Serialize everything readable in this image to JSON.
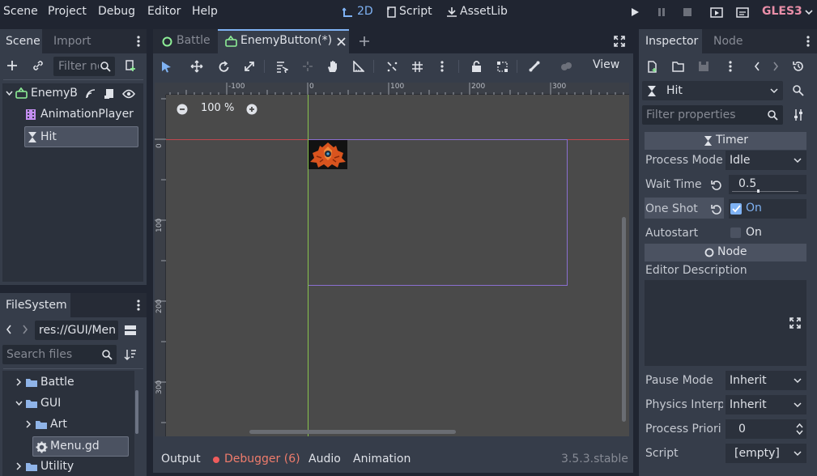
{
  "menu": {
    "scene": "Scene",
    "project": "Project",
    "debug": "Debug",
    "editor": "Editor",
    "help": "Help"
  },
  "workspaces": {
    "view2d": "2D",
    "script": "Script",
    "assetlib": "AssetLib"
  },
  "renderer": "GLES3",
  "scene_dock": {
    "tab_scene": "Scene",
    "tab_import": "Import",
    "filter_placeholder": "Filter nodes",
    "tree": [
      {
        "label": "EnemyB",
        "type": "root"
      },
      {
        "label": "AnimationPlayer",
        "type": "animation"
      },
      {
        "label": "Hit",
        "type": "timer"
      }
    ]
  },
  "filesystem": {
    "tab": "FileSystem",
    "path": "res://GUI/Menu",
    "search_placeholder": "Search files",
    "items": [
      {
        "label": "Battle"
      },
      {
        "label": "GUI"
      },
      {
        "label": "Art"
      },
      {
        "label": "Menu.gd"
      },
      {
        "label": "Utility"
      }
    ]
  },
  "editor_tabs": {
    "tab1": "Battle",
    "tab2": "EnemyButton(*)"
  },
  "toolbar": {
    "view": "View"
  },
  "canvas": {
    "zoom": "100 %",
    "ruler_h": [
      "-100",
      "0",
      "100",
      "200",
      "300"
    ],
    "ruler_v": [
      "0",
      "100",
      "200",
      "300"
    ]
  },
  "bottom": {
    "output": "Output",
    "debugger": "Debugger (6)",
    "audio": "Audio",
    "animation": "Animation",
    "version": "3.5.3.stable"
  },
  "inspector": {
    "tab_inspector": "Inspector",
    "tab_node": "Node",
    "node_name": "Hit",
    "filter_placeholder": "Filter properties",
    "section_timer": "Timer",
    "process_mode_label": "Process Mode",
    "process_mode_value": "Idle",
    "wait_time_label": "Wait Time",
    "wait_time_value": "0.5",
    "one_shot_label": "One Shot",
    "one_shot_value": "On",
    "autostart_label": "Autostart",
    "autostart_value": "On",
    "section_node": "Node",
    "editor_description_label": "Editor Description",
    "pause_mode_label": "Pause Mode",
    "pause_mode_value": "Inherit",
    "physics_interp_label": "Physics Interp",
    "physics_interp_value": "Inherit",
    "process_priority_label": "Process Priori",
    "process_priority_value": "0",
    "script_label": "Script",
    "script_value": "[empty]"
  },
  "colors": {
    "accent": "#7fb2f3",
    "background": "#202531",
    "panel": "#363d4a",
    "viewport": "#4a4a4a",
    "debugger_dot": "#ef5c5c"
  }
}
